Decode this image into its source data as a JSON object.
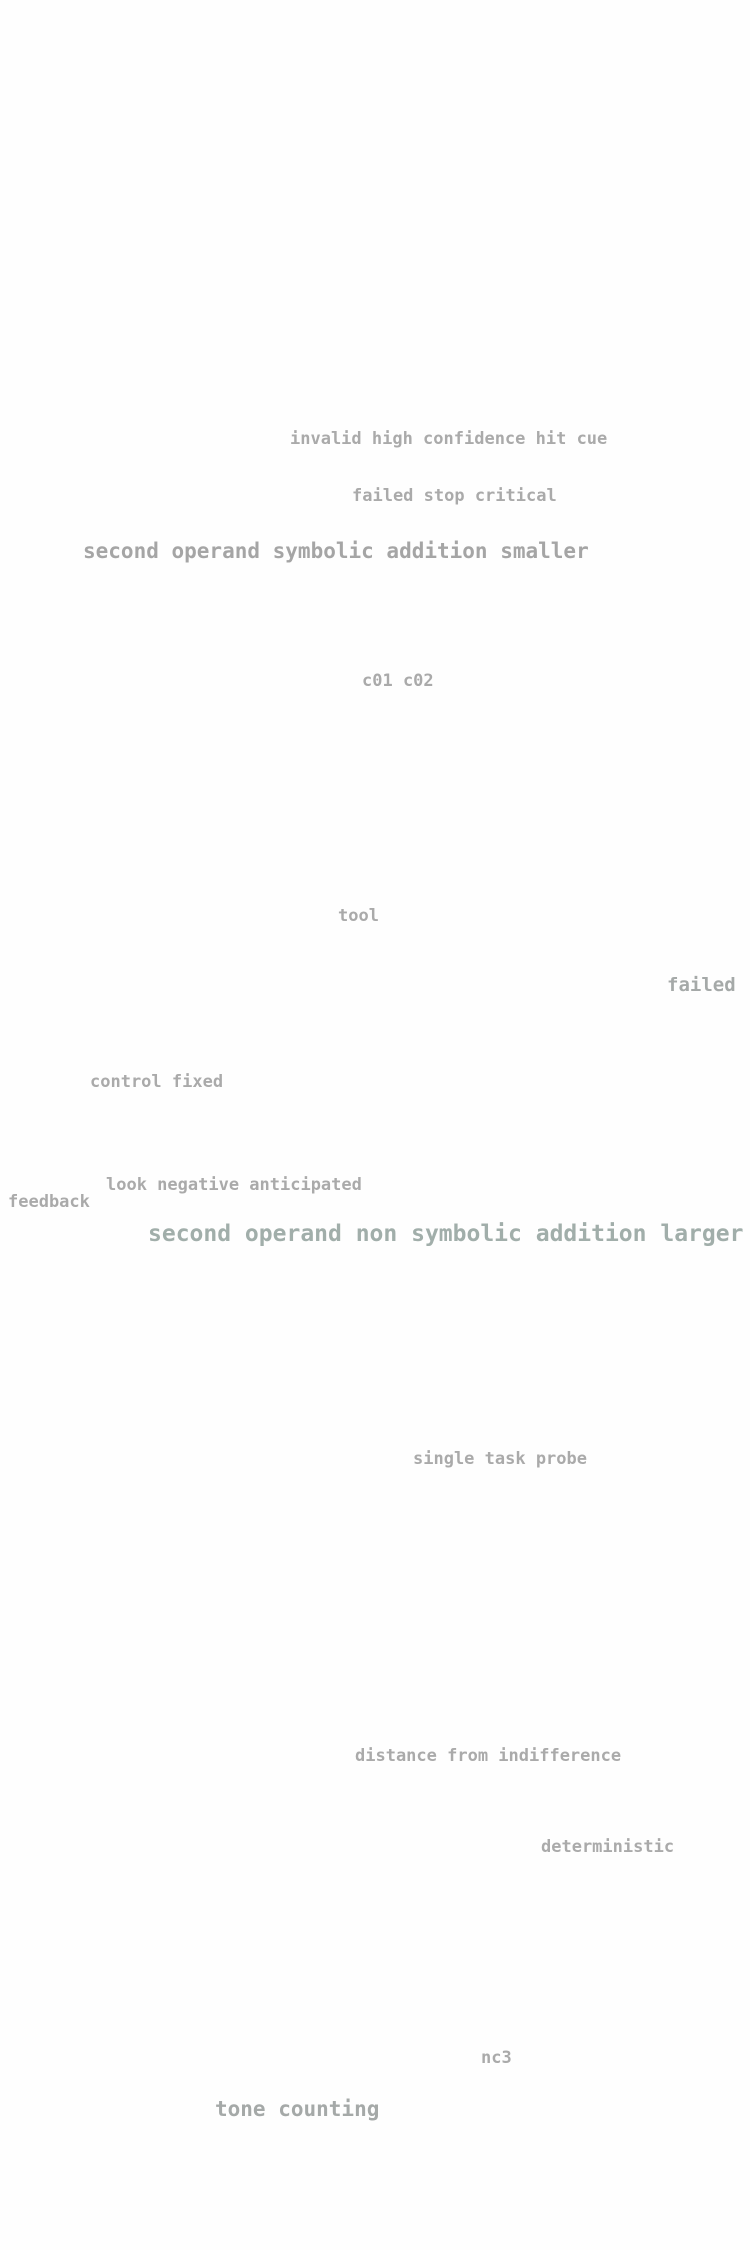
{
  "terms": [
    {
      "text": "invalid high confidence hit cue",
      "color": "#aaaaaa"
    },
    {
      "text": "failed stop critical",
      "color": "#aaaaaa"
    },
    {
      "text": "second operand symbolic addition smaller",
      "color": "#a5a5a5"
    },
    {
      "text": "c01 c02",
      "color": "#aaaaaa"
    },
    {
      "text": "tool",
      "color": "#aaaaaa"
    },
    {
      "text": "failed",
      "color": "#a5a9a8"
    },
    {
      "text": "control fixed",
      "color": "#aaaaaa"
    },
    {
      "text": "look negative anticipated",
      "color": "#aaaaaa"
    },
    {
      "text": "feedback",
      "color": "#aaaaaa"
    },
    {
      "text": "second operand non symbolic addition larger",
      "color": "#a1aeaa"
    },
    {
      "text": "single task probe",
      "color": "#aaaaaa"
    },
    {
      "text": "distance from indifference",
      "color": "#aaaaaa"
    },
    {
      "text": "deterministic",
      "color": "#aaaaaa"
    },
    {
      "text": "nc3",
      "color": "#aaaaaa"
    },
    {
      "text": "tone counting",
      "color": "#a5a9a8"
    }
  ]
}
